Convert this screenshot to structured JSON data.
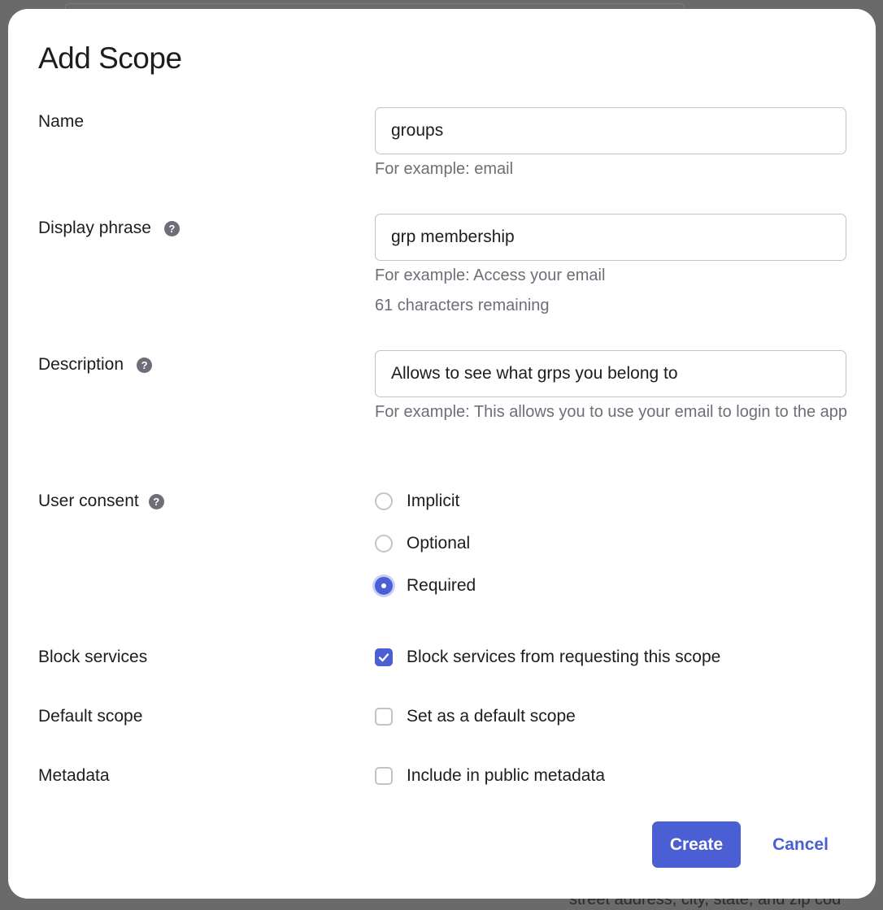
{
  "background": {
    "footer_text": "street address, city, state, and zip cod"
  },
  "modal": {
    "title": "Add Scope",
    "name": {
      "label": "Name",
      "value": "groups",
      "hint": "For example: email"
    },
    "display_phrase": {
      "label": "Display phrase",
      "value": "grp membership",
      "hint": "For example: Access your email",
      "remaining": "61 characters remaining"
    },
    "description": {
      "label": "Description",
      "value": "Allows to see what grps you belong to",
      "hint": "For example: This allows you to use your email to login to the app"
    },
    "user_consent": {
      "label": "User consent",
      "options": [
        "Implicit",
        "Optional",
        "Required"
      ],
      "selected": "Required"
    },
    "block_services": {
      "label": "Block services",
      "option": "Block services from requesting this scope",
      "checked": true
    },
    "default_scope": {
      "label": "Default scope",
      "option": "Set as a default scope",
      "checked": false
    },
    "metadata": {
      "label": "Metadata",
      "option": "Include in public metadata",
      "checked": false
    },
    "buttons": {
      "create": "Create",
      "cancel": "Cancel"
    }
  },
  "colors": {
    "accent": "#4b5fd4",
    "overlay": "#5b5b5b",
    "hint_text": "#6e6e78"
  },
  "icons": {
    "help": "help-circle-icon",
    "check": "checkmark-icon"
  }
}
